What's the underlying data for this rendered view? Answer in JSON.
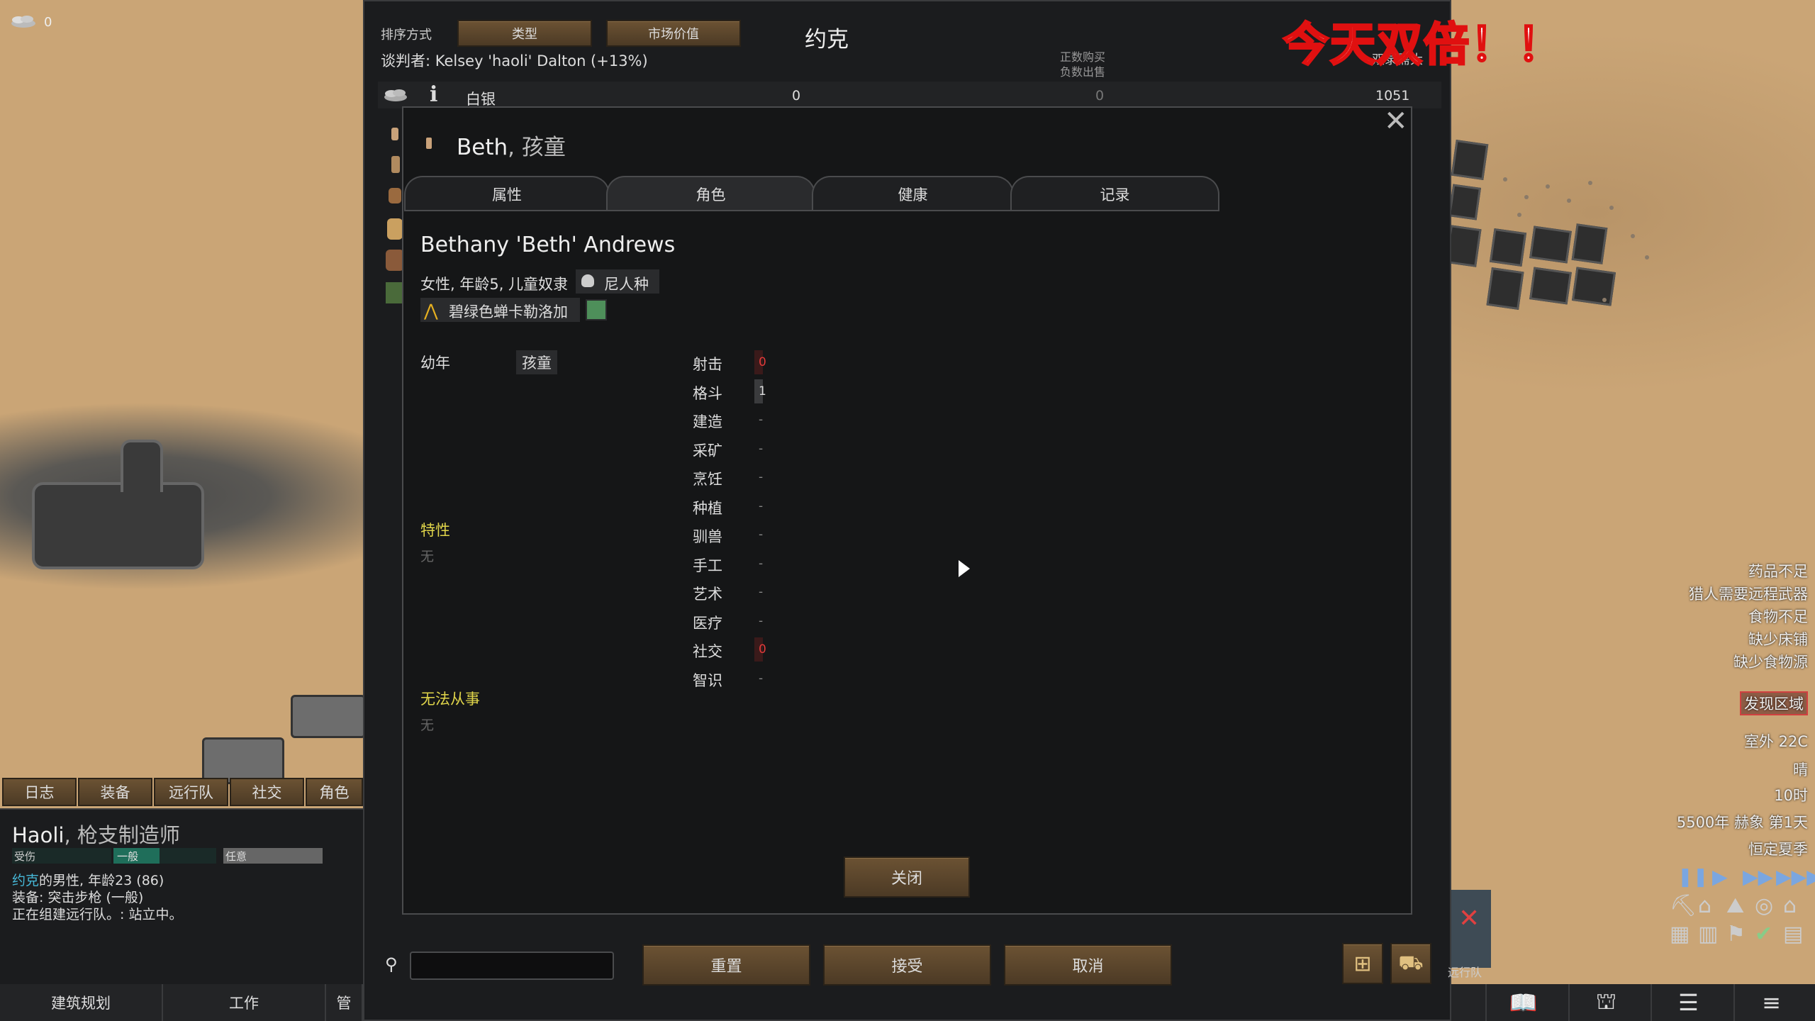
{
  "top_left": {
    "silver_count": "0"
  },
  "trade": {
    "sort_label": "排序方式",
    "sort_type_button": "类型",
    "sort_value_button": "市场价值",
    "trader_name": "约克",
    "negotiator": "谈判者: Kelsey 'haoli' Dalton (+13%)",
    "legend_buy": "正数购买",
    "legend_sell": "负数出售",
    "legend_right": "双录需大",
    "silver_row": {
      "label": "白银",
      "colony_amount": "0",
      "trade_amount": "0",
      "trader_amount": "1051"
    },
    "search_placeholder": "",
    "reset_button": "重置",
    "accept_button": "接受",
    "cancel_button": "取消"
  },
  "overlay_text": "今天双倍！！",
  "dialog": {
    "title_name": "Beth",
    "title_role": ", 孩童",
    "tabs": [
      "属性",
      "角色",
      "健康",
      "记录"
    ],
    "full_name": "Bethany 'Beth' Andrews",
    "description": "女性, 年龄5, 儿童奴隶",
    "xenotype": "尼人种",
    "ideology": "碧绿色蝉卡勒洛加",
    "childhood_label": "幼年",
    "childhood_value": "孩童",
    "traits_label": "特性",
    "traits_value": "无",
    "incapable_label": "无法从事",
    "incapable_value": "无",
    "close_button": "关闭",
    "skills": [
      {
        "name": "射击",
        "value": "0",
        "level": 0,
        "red": true
      },
      {
        "name": "格斗",
        "value": "1",
        "level": 1,
        "red": false
      },
      {
        "name": "建造",
        "value": "-",
        "level": 0,
        "red": false
      },
      {
        "name": "采矿",
        "value": "-",
        "level": 0,
        "red": false
      },
      {
        "name": "烹饪",
        "value": "-",
        "level": 0,
        "red": false
      },
      {
        "name": "种植",
        "value": "-",
        "level": 0,
        "red": false
      },
      {
        "name": "驯兽",
        "value": "-",
        "level": 0,
        "red": false
      },
      {
        "name": "手工",
        "value": "-",
        "level": 0,
        "red": false
      },
      {
        "name": "艺术",
        "value": "-",
        "level": 0,
        "red": false
      },
      {
        "name": "医疗",
        "value": "-",
        "level": 0,
        "red": false
      },
      {
        "name": "社交",
        "value": "0",
        "level": 0,
        "red": true
      },
      {
        "name": "智识",
        "value": "-",
        "level": 0,
        "red": false
      }
    ]
  },
  "left_panel": {
    "tabs": [
      "日志",
      "装备",
      "远行队",
      "社交",
      "角色"
    ],
    "pawn_name": "Haoli",
    "pawn_title": ", 枪支制造师",
    "bar_injured": "受伤",
    "bar_mood": "一般",
    "bar_any": "任意",
    "faction_link": "约克",
    "desc_rest": "的男性, 年龄23 (86)",
    "equipment": "装备: 突击步枪 (一般)",
    "status": "正在组建远行队。: 站立中。"
  },
  "main_tabs": [
    "建筑规划",
    "工作",
    "管"
  ],
  "alerts": [
    "药品不足",
    "猎人需要远程武器",
    "食物不足",
    "缺少床铺",
    "缺少食物源"
  ],
  "discover_zone": "发现区域",
  "weather": {
    "temperature": "室外 22C",
    "condition": "晴",
    "time": "10时",
    "date": "5500年 赫象 第1天",
    "season": "恒定夏季"
  },
  "caravan_label": "远行队",
  "colors": {
    "accent_yellow": "#e0d54a",
    "red": "#e23a3a",
    "brown": "#5c4629",
    "green": "#4e8f5a"
  }
}
